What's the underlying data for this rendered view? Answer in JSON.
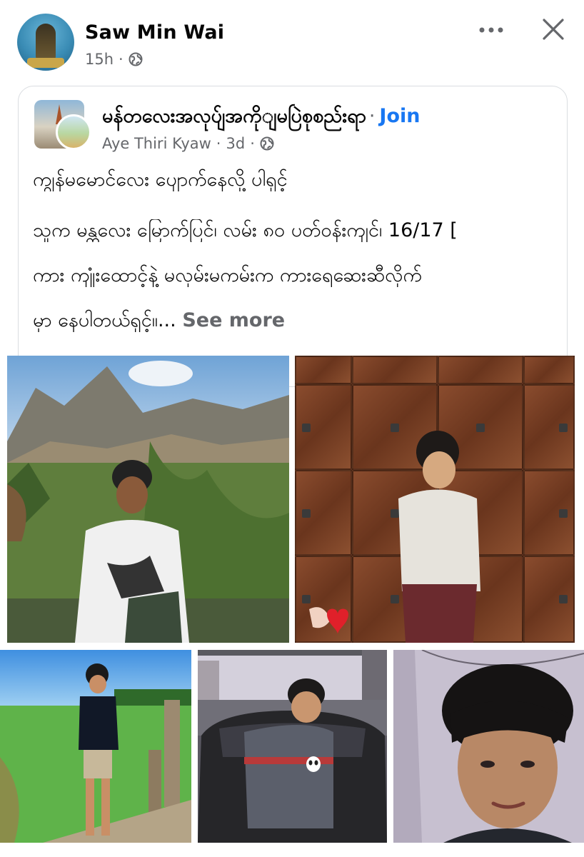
{
  "post": {
    "author": "Saw Min Wai",
    "time": "15h",
    "dot": "·",
    "audience_icon": "globe-icon",
    "more_icon": "more-horizontal-icon",
    "close_icon": "close-icon"
  },
  "shared": {
    "group_name": "မန်တလေးအလုပ်ျအကိုျမပြဲစုစည်းရာ",
    "separator": "·",
    "join_label": "Join",
    "author": "Aye Thiri Kyaw",
    "time": "3d",
    "dot": "·",
    "audience_icon": "globe-icon",
    "text_lines": [
      "ကျွန်မမောင်လေး ပျောက်နေလို့ ပါရှင့်",
      "သူက မန္တလေး မြောက်ပြင်၊ လမ်း ၈၀ ပတ်ဝန်းကျင်၊ 16/17 [",
      "ကား ကျုံးထောင့်နဲ့ မလှမ်းမကမ်းက ကားရေဆေးဆီလိုက်",
      "မှာ နေပါတယ်ရှင့်။..."
    ],
    "see_more": "See more"
  },
  "photos": [
    {
      "name": "photo-boy-mountains"
    },
    {
      "name": "photo-boy-wooden-door"
    },
    {
      "name": "photo-boy-field"
    },
    {
      "name": "photo-boy-car"
    },
    {
      "name": "photo-boy-selfie"
    }
  ],
  "colors": {
    "text": "#050505",
    "secondary": "#65676b",
    "link": "#1877f2",
    "border": "#dadde1"
  }
}
